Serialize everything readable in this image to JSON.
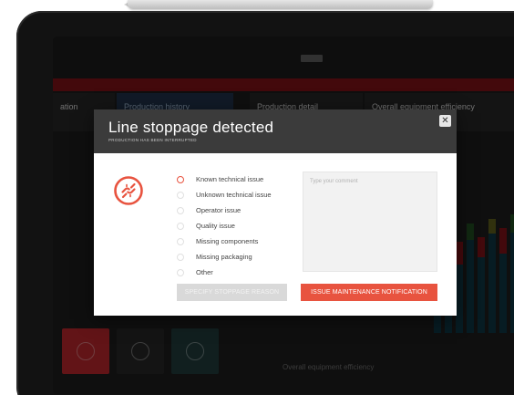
{
  "background": {
    "panels": [
      "ation",
      "Production history",
      "Production detail",
      "Overall equipment efficiency"
    ],
    "labels": [
      "Overall equipment efficiency"
    ],
    "colors": {
      "bar": "#7a1216",
      "tile_red": "#b3262b",
      "tile_dark": "#262626",
      "tile_teal": "#1f3a3a"
    }
  },
  "modal": {
    "title": "Line stoppage detected",
    "subtitle": "PRODUCTION HAS BEEN INTERRUPTED",
    "close_glyph": "✕",
    "icon": "broken-chain-icon",
    "options": [
      {
        "label": "Known technical issue",
        "selected": true
      },
      {
        "label": "Unknown technical issue",
        "selected": false
      },
      {
        "label": "Operator issue",
        "selected": false
      },
      {
        "label": "Quality issue",
        "selected": false
      },
      {
        "label": "Missing components",
        "selected": false
      },
      {
        "label": "Missing packaging",
        "selected": false
      },
      {
        "label": "Other",
        "selected": false
      }
    ],
    "comment": {
      "placeholder": "Type your comment",
      "value": ""
    },
    "specify_button": "SPECIFY STOPPAGE REASON",
    "issue_button": "ISSUE MAINTENANCE NOTIFICATION",
    "colors": {
      "accent": "#e8533f",
      "header": "#3b3b3b",
      "disabled": "#d9d9d9"
    }
  }
}
